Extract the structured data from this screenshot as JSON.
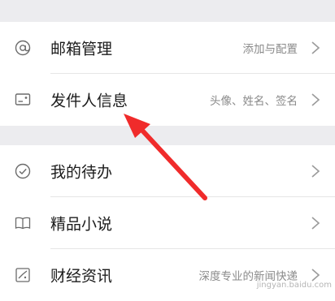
{
  "section1": {
    "items": [
      {
        "label": "邮箱管理",
        "value": "添加与配置",
        "icon": "at-icon"
      },
      {
        "label": "发件人信息",
        "value": "头像、姓名、签名",
        "icon": "id-card-icon"
      }
    ]
  },
  "section2": {
    "items": [
      {
        "label": "我的待办",
        "value": "",
        "icon": "check-circle-icon"
      },
      {
        "label": "精品小说",
        "value": "",
        "icon": "book-icon"
      },
      {
        "label": "财经资讯",
        "value": "深度专业的新闻快递",
        "icon": "chart-icon"
      }
    ]
  },
  "annotation": {
    "color": "#f02b2b"
  },
  "watermark": "jingyan.baidu.com"
}
